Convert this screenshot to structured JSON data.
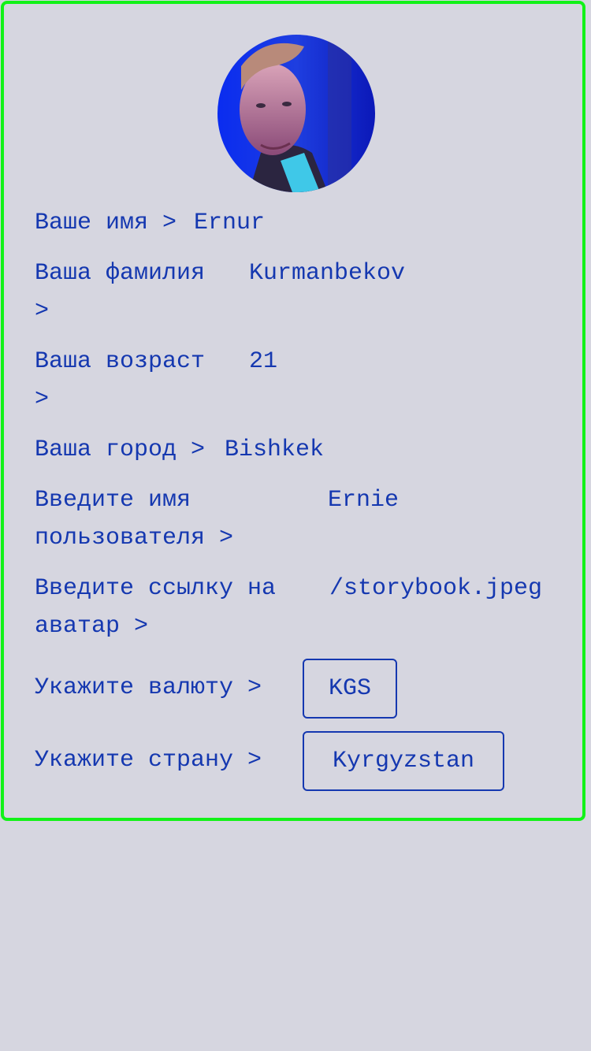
{
  "profile": {
    "avatar_icon": "user-photo-avatar",
    "name_label": "Ваше имя >",
    "name_value": "Ernur",
    "surname_label_line1": "Ваша фамилия",
    "surname_label_line2": ">",
    "surname_value": "Kurmanbekov",
    "age_label_line1": "Ваша возраст",
    "age_label_line2": ">",
    "age_value": "21",
    "city_label": "Ваша город >",
    "city_value": "Bishkek",
    "username_label_line1": "Введите имя",
    "username_label_line2": "пользователя >",
    "username_value": "Ernie",
    "avatar_link_label_line1": "Введите ссылку на",
    "avatar_link_label_line2": "аватар >",
    "avatar_link_value": "/storybook.jpeg",
    "currency_label": "Укажите валюту >",
    "currency_value": "KGS",
    "country_label": "Укажите страну >",
    "country_value": "Kyrgyzstan"
  },
  "colors": {
    "text": "#1538b0",
    "border": "#12f218",
    "background": "#d6d6e0"
  }
}
